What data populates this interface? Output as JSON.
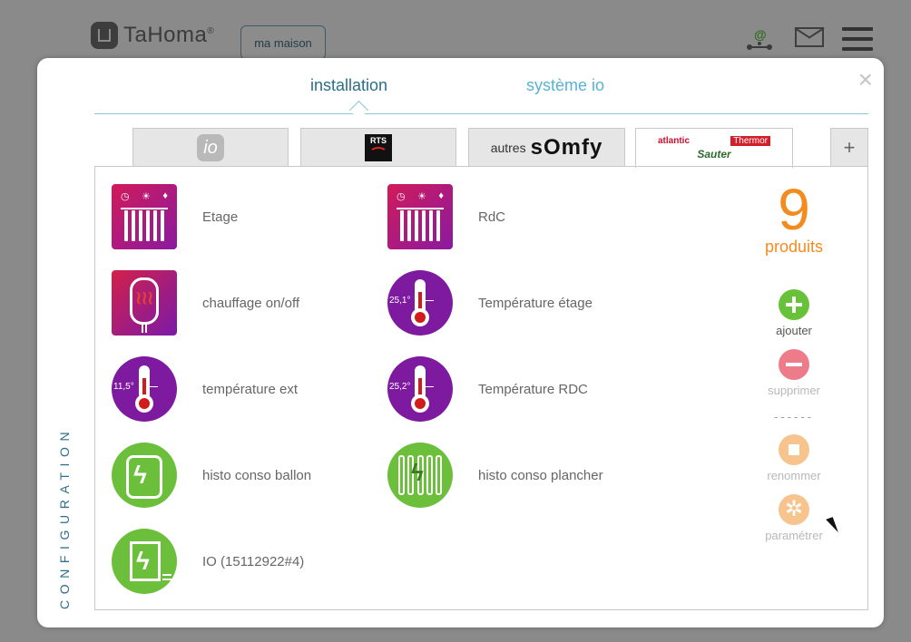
{
  "header": {
    "brand": "TaHoma",
    "brand_mark": "®",
    "house_button": "ma maison",
    "icons": [
      "logo-house-icon",
      "at-network-icon",
      "mail-icon",
      "hamburger-menu-icon"
    ]
  },
  "modal": {
    "tabs": [
      "installation",
      "système io"
    ],
    "side_label": "CONFIGURATION",
    "close_icon": "×",
    "brand_tabs": {
      "io": "io",
      "rts": "RTS",
      "autres": "autres",
      "somfy": "sOmfy",
      "atlantic": "atlantic",
      "thermor": "Thermor",
      "sauter": "Sauter",
      "plus": "+"
    },
    "devices": [
      {
        "label": "Etage",
        "icon": "radiator-icon"
      },
      {
        "label": "RdC",
        "icon": "radiator-icon"
      },
      {
        "label": "chauffage on/off",
        "icon": "heater-icon"
      },
      {
        "label": "Température étage",
        "icon": "thermometer-icon",
        "value": "25,1°"
      },
      {
        "label": "température ext",
        "icon": "thermometer-icon",
        "value": "11,5°"
      },
      {
        "label": "Température RDC",
        "icon": "thermometer-icon",
        "value": "25,2°"
      },
      {
        "label": "histo conso ballon",
        "icon": "water-heater-energy-icon"
      },
      {
        "label": "histo conso plancher",
        "icon": "floor-heating-energy-icon"
      },
      {
        "label": "IO (15112922#4)",
        "icon": "io-energy-icon"
      }
    ],
    "summary": {
      "count": "9",
      "count_label": "produits"
    },
    "actions": {
      "add": "ajouter",
      "delete": "supprimer",
      "separator": "------",
      "rename": "renommer",
      "settings": "paramétrer"
    },
    "colors": {
      "accent_blue": "#2a6e8a",
      "accent_orange": "#f28c1e",
      "add_green": "#67c23a",
      "delete_pink": "#ee7b8a",
      "rename_peach": "#f7c48d"
    }
  }
}
